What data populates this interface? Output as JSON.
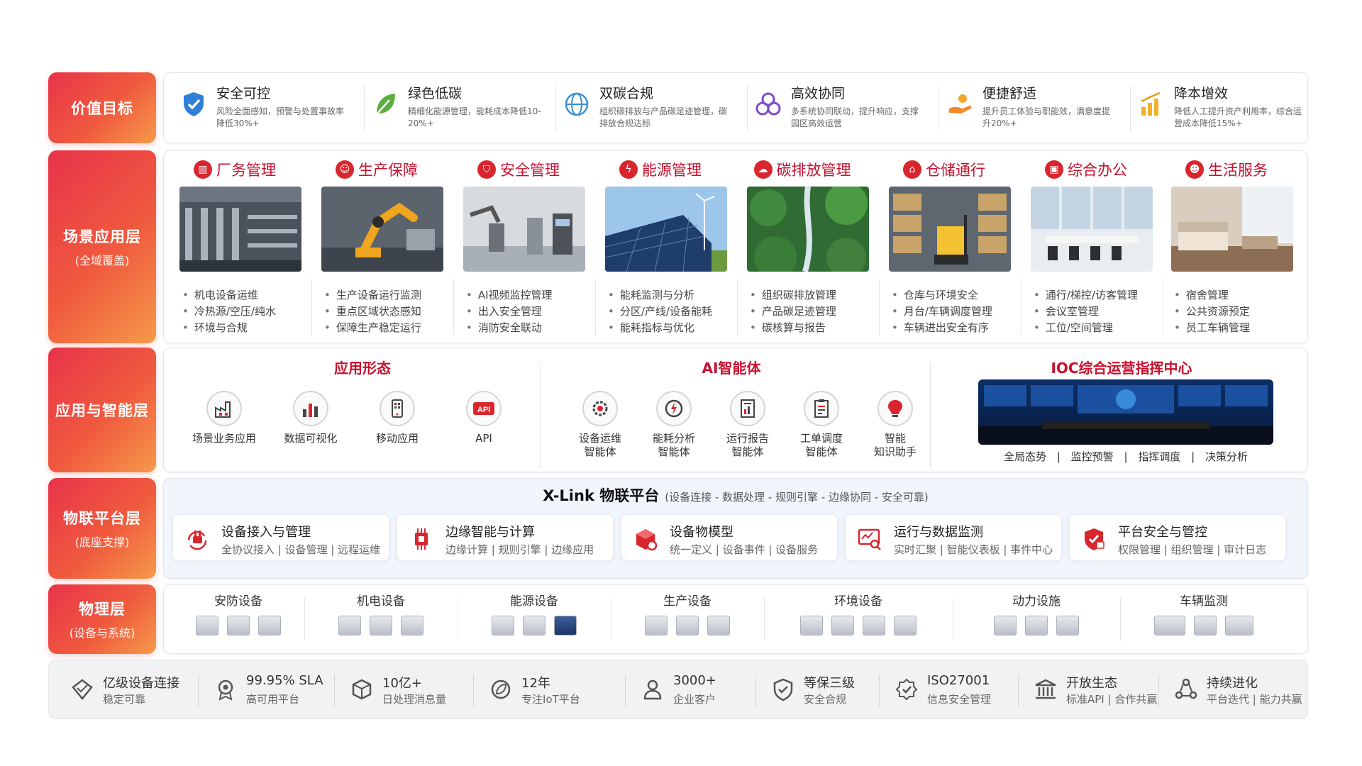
{
  "layers": {
    "value": {
      "title": "价值目标"
    },
    "scenario": {
      "title": "场景应用层",
      "subtitle": "(全域覆盖)"
    },
    "app": {
      "title": "应用与智能层"
    },
    "iot": {
      "title": "物联平台层",
      "subtitle": "(底座支撑)"
    },
    "physical": {
      "title": "物理层",
      "subtitle": "(设备与系统)"
    }
  },
  "values": [
    {
      "title": "安全可控",
      "desc": "风险全面感知，预警与处置事故率降低30%+",
      "icon": "shield-check-icon",
      "color": "#2f7fd9"
    },
    {
      "title": "绿色低碳",
      "desc": "精细化能源管理，能耗成本降低10-20%+",
      "icon": "leaf-icon",
      "color": "#5aae3e"
    },
    {
      "title": "双碳合规",
      "desc": "组织碳排放与产品碳足迹管理，碳排放合规达标",
      "icon": "globe-co2-icon",
      "color": "#3b8fd6"
    },
    {
      "title": "高效协同",
      "desc": "多系统协同联动，提升响应，支撑园区高效运营",
      "icon": "collaboration-icon",
      "color": "#7d4cc4"
    },
    {
      "title": "便捷舒适",
      "desc": "提升员工体验与职能效，满意度提升20%+",
      "icon": "hand-comfort-icon",
      "color": "#f08a2b"
    },
    {
      "title": "降本增效",
      "desc": "降低人工提升资产利用率，综合运营成本降低15%+",
      "icon": "coins-chart-icon",
      "color": "#f2b12b"
    }
  ],
  "scenes": [
    {
      "title": "厂务管理",
      "icon": "factory-icon",
      "items": [
        "机电设备运维",
        "冷热源/空压/纯水",
        "环境与合规"
      ]
    },
    {
      "title": "生产保障",
      "icon": "worker-icon",
      "items": [
        "生产设备运行监测",
        "重点区域状态感知",
        "保障生产稳定运行"
      ]
    },
    {
      "title": "安全管理",
      "icon": "shield-icon",
      "items": [
        "AI视频监控管理",
        "出入安全管理",
        "消防安全联动"
      ]
    },
    {
      "title": "能源管理",
      "icon": "energy-icon",
      "items": [
        "能耗监测与分析",
        "分区/产线/设备能耗",
        "能耗指标与优化"
      ]
    },
    {
      "title": "碳排放管理",
      "icon": "co2-icon",
      "items": [
        "组织碳排放管理",
        "产品碳足迹管理",
        "碳核算与报告"
      ]
    },
    {
      "title": "仓储通行",
      "icon": "warehouse-icon",
      "items": [
        "仓库与环境安全",
        "月台/车辆调度管理",
        "车辆进出安全有序"
      ]
    },
    {
      "title": "综合办公",
      "icon": "briefcase-icon",
      "items": [
        "通行/梯控/访客管理",
        "会议室管理",
        "工位/空间管理"
      ]
    },
    {
      "title": "生活服务",
      "icon": "user-service-icon",
      "items": [
        "宿舍管理",
        "公共资源预定",
        "员工车辆管理"
      ]
    }
  ],
  "app_forms": {
    "title": "应用形态",
    "items": [
      {
        "label": "场景业务应用",
        "icon": "factory-app-icon"
      },
      {
        "label": "数据可视化",
        "icon": "bar-chart-icon"
      },
      {
        "label": "移动应用",
        "icon": "mobile-icon"
      },
      {
        "label": "API",
        "icon": "api-icon"
      }
    ]
  },
  "ai_agents": {
    "title": "AI智能体",
    "items": [
      {
        "label": "设备运维智能体",
        "line1": "设备运维",
        "line2": "智能体",
        "icon": "gear-wrench-icon"
      },
      {
        "label": "能耗分析智能体",
        "line1": "能耗分析",
        "line2": "智能体",
        "icon": "gauge-bolt-icon"
      },
      {
        "label": "运行报告智能体",
        "line1": "运行报告",
        "line2": "智能体",
        "icon": "report-icon"
      },
      {
        "label": "工单调度智能体",
        "line1": "工单调度",
        "line2": "智能体",
        "icon": "work-order-icon"
      },
      {
        "label": "智能知识助手",
        "line1": "智能",
        "line2": "知识助手",
        "icon": "brain-bulb-icon"
      }
    ]
  },
  "ioc": {
    "title": "IOC综合运营指挥中心",
    "tags": [
      "全局态势",
      "监控预警",
      "指挥调度",
      "决策分析"
    ],
    "separator": "|"
  },
  "iot_platform": {
    "title": "X-Link 物联平台",
    "subtitle": "(设备连接 - 数据处理 - 规则引擎 - 边缘协同 - 安全可靠)",
    "cards": [
      {
        "title": "设备接入与管理",
        "desc": "全协议接入 | 设备管理 | 远程运维",
        "icon": "plug-icon"
      },
      {
        "title": "边缘智能与计算",
        "desc": "边缘计算 | 规则引擎 | 边缘应用",
        "icon": "chip-icon"
      },
      {
        "title": "设备物模型",
        "desc": "统一定义 | 设备事件 | 设备服务",
        "icon": "cube-gear-icon"
      },
      {
        "title": "运行与数据监测",
        "desc": "实时汇聚 | 智能仪表板 | 事件中心",
        "icon": "monitor-search-icon"
      },
      {
        "title": "平台安全与管控",
        "desc": "权限管理 | 组织管理 | 审计日志",
        "icon": "shield-lock-icon"
      }
    ]
  },
  "physical": [
    {
      "title": "安防设备",
      "icons": [
        "camera-icon",
        "access-panel-icon",
        "gate-icon"
      ]
    },
    {
      "title": "机电设备",
      "icons": [
        "chiller-icon",
        "pipe-valve-icon",
        "pump-icon"
      ]
    },
    {
      "title": "能源设备",
      "icons": [
        "cabinet-icon",
        "transformer-icon",
        "solar-panel-icon"
      ]
    },
    {
      "title": "生产设备",
      "icons": [
        "tank-icon",
        "machine-icon",
        "cnc-icon"
      ]
    },
    {
      "title": "环境设备",
      "icons": [
        "sensor-icon",
        "detector-icon",
        "meter-icon",
        "smoke-detector-icon"
      ]
    },
    {
      "title": "动力设施",
      "icons": [
        "electric-cabinet-icon",
        "compressor-icon",
        "switchgear-icon"
      ]
    },
    {
      "title": "车辆监测",
      "icons": [
        "truck-icon",
        "forklift-icon",
        "agv-icon"
      ]
    }
  ],
  "stats": [
    {
      "title": "亿级设备连接",
      "desc": "稳定可靠",
      "icon": "diamond-icon"
    },
    {
      "title": "99.95% SLA",
      "desc": "高可用平台",
      "icon": "badge-icon"
    },
    {
      "title": "10亿+",
      "desc": "日处理消息量",
      "icon": "box-icon"
    },
    {
      "title": "12年",
      "desc": "专注IoT平台",
      "icon": "leaf-chip-icon"
    },
    {
      "title": "3000+",
      "desc": "企业客户",
      "icon": "person-icon"
    },
    {
      "title": "等保三级",
      "desc": "安全合规",
      "icon": "shield-outline-icon"
    },
    {
      "title": "ISO27001",
      "desc": "信息安全管理",
      "icon": "certificate-icon"
    },
    {
      "title": "开放生态",
      "desc": "标准API | 合作共赢",
      "icon": "bank-icon"
    },
    {
      "title": "持续进化",
      "desc": "平台迭代 | 能力共赢",
      "icon": "cycle-icon"
    }
  ],
  "colors": {
    "accent": "#c8102e",
    "label_gradient_start": "#e8334a",
    "label_gradient_end": "#f59a4a"
  }
}
